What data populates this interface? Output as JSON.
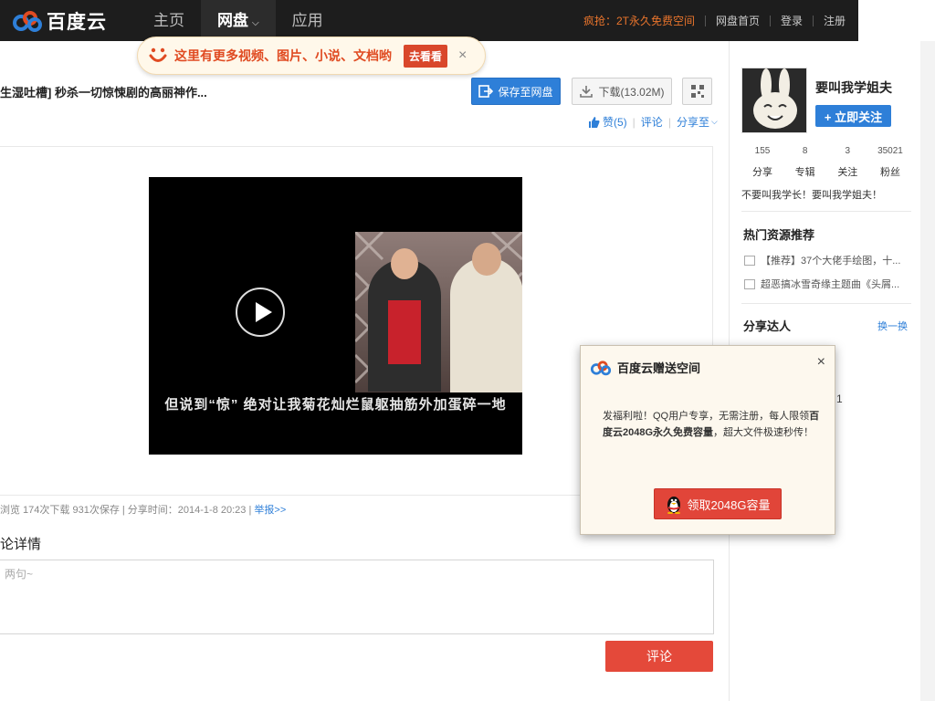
{
  "header": {
    "logo_text": "百度云",
    "nav": [
      {
        "label": "主页",
        "active": false
      },
      {
        "label": "网盘",
        "active": true
      },
      {
        "label": "应用",
        "active": false
      }
    ],
    "promo": "疯抢：2T永久免费空间",
    "links": [
      "网盘首页",
      "登录",
      "注册"
    ]
  },
  "bubble": {
    "text": "这里有更多视频、图片、小说、文档哟",
    "button": "去看看",
    "close": "×"
  },
  "file": {
    "title": "生湿吐槽] 秒杀一切惊悚剧的高丽神作...",
    "save_label": "保存至网盘",
    "download_label": "下载(13.02M)",
    "like_label": "赞(5)",
    "comment_label": "评论",
    "share_label": "分享至"
  },
  "video": {
    "subtitle": "但说到“惊” 绝对让我菊花灿烂鼠躯抽筋外加蛋碎一地"
  },
  "stats": {
    "text": "浏览  174次下载  931次保存 | 分享时间：2014-1-8 20:23 |",
    "report": "举报>>"
  },
  "comments": {
    "title": "论详情",
    "placeholder": "两句~",
    "submit": "评论"
  },
  "profile": {
    "name": "要叫我学姐夫",
    "follow": "+ 立即关注",
    "counts": [
      {
        "num": "155",
        "label": "分享"
      },
      {
        "num": "8",
        "label": "专辑"
      },
      {
        "num": "3",
        "label": "关注"
      },
      {
        "num": "35021",
        "label": "粉丝"
      }
    ],
    "bio": "不要叫我学长！要叫我学姐夫！"
  },
  "hot": {
    "title": "热门资源推荐",
    "items": [
      "【推荐】37个大佬手绘图，十...",
      "超恶搞冰雪奇缘主题曲《头屑..."
    ]
  },
  "share_experts": {
    "title": "分享达人",
    "more": "换一换"
  },
  "dialog": {
    "title": "百度云赠送空间",
    "body_1": "发福利啦！QQ用户专享，无需注册，每人限领",
    "body_bold": "百度云2048G永久免费容量",
    "body_2": "，超大文件极速秒传！",
    "button": "领取2048G容量",
    "close": "×"
  },
  "partial_text": "1",
  "colors": {
    "brand_blue": "#2e7fd8",
    "accent_red": "#e4493a",
    "topbar": "#1d1d1d"
  }
}
